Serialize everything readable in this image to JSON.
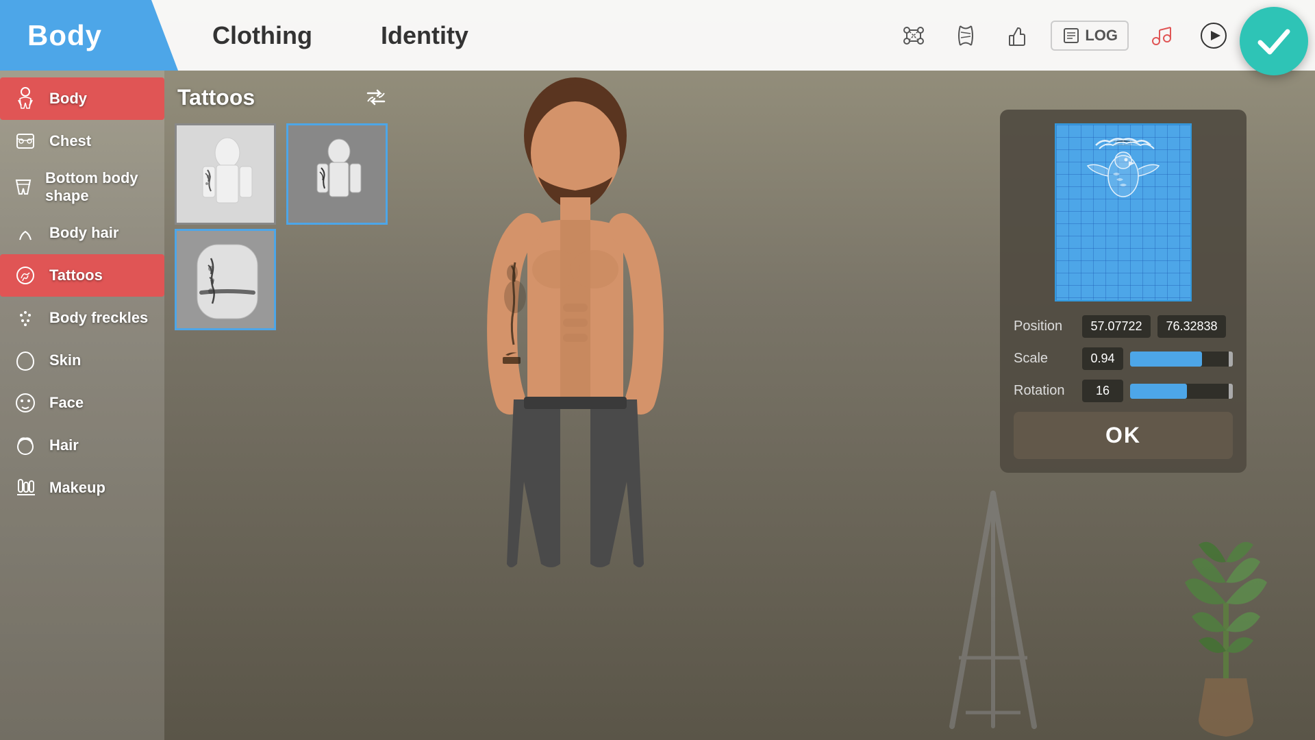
{
  "nav": {
    "body_tab": "Body",
    "clothing_tab": "Clothing",
    "identity_tab": "Identity",
    "log_label": "LOG"
  },
  "sidebar": {
    "items": [
      {
        "id": "body",
        "label": "Body",
        "icon": "👤",
        "active": true
      },
      {
        "id": "chest",
        "label": "Chest",
        "icon": "🫀"
      },
      {
        "id": "bottom-body-shape",
        "label": "Bottom body shape",
        "icon": "👖"
      },
      {
        "id": "body-hair",
        "label": "Body hair",
        "icon": "🦱"
      },
      {
        "id": "tattoos",
        "label": "Tattoos",
        "icon": "🎨",
        "active_tattoos": true
      },
      {
        "id": "body-freckles",
        "label": "Body freckles",
        "icon": "⭕"
      },
      {
        "id": "skin",
        "label": "Skin",
        "icon": "🫲"
      },
      {
        "id": "face",
        "label": "Face",
        "icon": "😐"
      },
      {
        "id": "hair",
        "label": "Hair",
        "icon": "💇"
      },
      {
        "id": "makeup",
        "label": "Makeup",
        "icon": "💄"
      }
    ]
  },
  "tattoos_panel": {
    "title": "Tattoos",
    "shuffle_icon": "⇄",
    "items": [
      {
        "id": 1,
        "selected": false,
        "thumb": "1"
      },
      {
        "id": 2,
        "selected": true,
        "thumb": "2"
      },
      {
        "id": 3,
        "selected": true,
        "thumb": "3"
      }
    ]
  },
  "editor": {
    "position_label": "Position",
    "position_x": "57.07722",
    "position_y": "76.32838",
    "scale_label": "Scale",
    "scale_value": "0.94",
    "scale_percent": 70,
    "rotation_label": "Rotation",
    "rotation_value": "16",
    "rotation_percent": 55,
    "ok_label": "OK"
  },
  "icons": {
    "dna": "🧬",
    "thumbs_up": "👍",
    "log": "📋",
    "music": "🎵",
    "play": "▶"
  }
}
